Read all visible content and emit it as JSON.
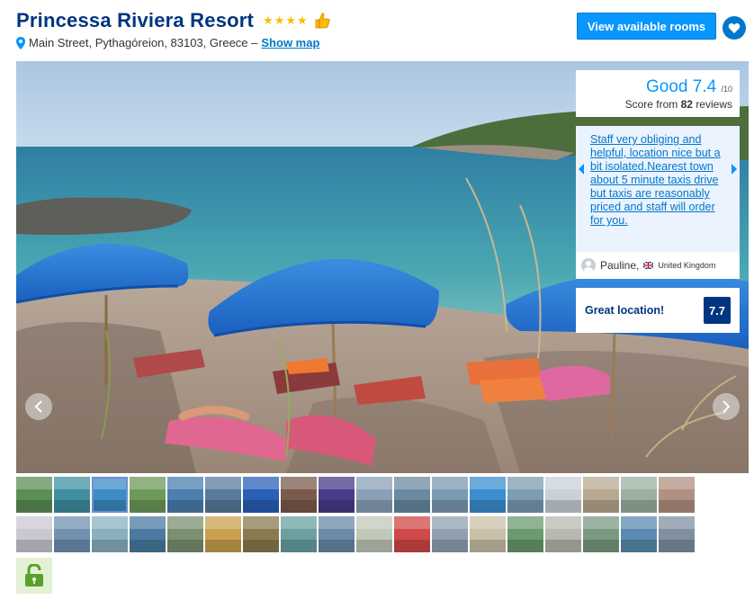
{
  "header": {
    "hotel_name": "Princessa Riviera Resort",
    "stars": "★★★★",
    "address": "Main Street, Pythagóreion, 83103, Greece –",
    "show_map": "Show map"
  },
  "actions": {
    "view_rooms": "View available rooms"
  },
  "score": {
    "word": "Good",
    "value": "7.4",
    "out_of": "/10",
    "prefix": "Score from",
    "count": "82",
    "suffix": "reviews"
  },
  "review": {
    "text": "Staff very obliging and helpful, location nice but a bit isolated.Nearest town about 5 minute taxis drive but taxis are reasonably priced and staff will order for you. ",
    "reviewer": "Pauline,",
    "country": "United Kingdom"
  },
  "location": {
    "label": "Great location!",
    "score": "7.7"
  },
  "colors": {
    "brand": "#003580",
    "accent": "#0896ff",
    "link": "#0077cc",
    "star": "#febb02"
  },
  "gallery": {
    "selected_index": 2,
    "row1": [
      "#5b8e57",
      "#3f8fa0",
      "#3e8cc4",
      "#6d9a58",
      "#4a7fb0",
      "#5a7a9c",
      "#2a5fb8",
      "#7a5a4a",
      "#473b8a",
      "#8aa0b8",
      "#6a8aa0",
      "#7a9ab0",
      "#3a8ed0",
      "#7c9cb2",
      "#c8d0d8",
      "#b8a890",
      "#9ab0a0",
      "#b09080"
    ],
    "row2": [
      "#c8c8d0",
      "#7090b0",
      "#8ab0c0",
      "#4a7aa0",
      "#7a9070",
      "#c8a050",
      "#8a7a50",
      "#6aa0a0",
      "#6a8aa8",
      "#c0c8b8",
      "#d04848",
      "#90a0b0",
      "#c8c0a8",
      "#6a9a70",
      "#b8b8b0",
      "#7a9a80",
      "#5a8ab0",
      "#8090a0"
    ]
  },
  "icons": {
    "pin": "map-pin-icon",
    "thumb": "thumbs-up-icon",
    "heart": "heart-icon",
    "unlock": "unlock-icon",
    "prev": "chevron-left-icon",
    "next": "chevron-right-icon"
  }
}
